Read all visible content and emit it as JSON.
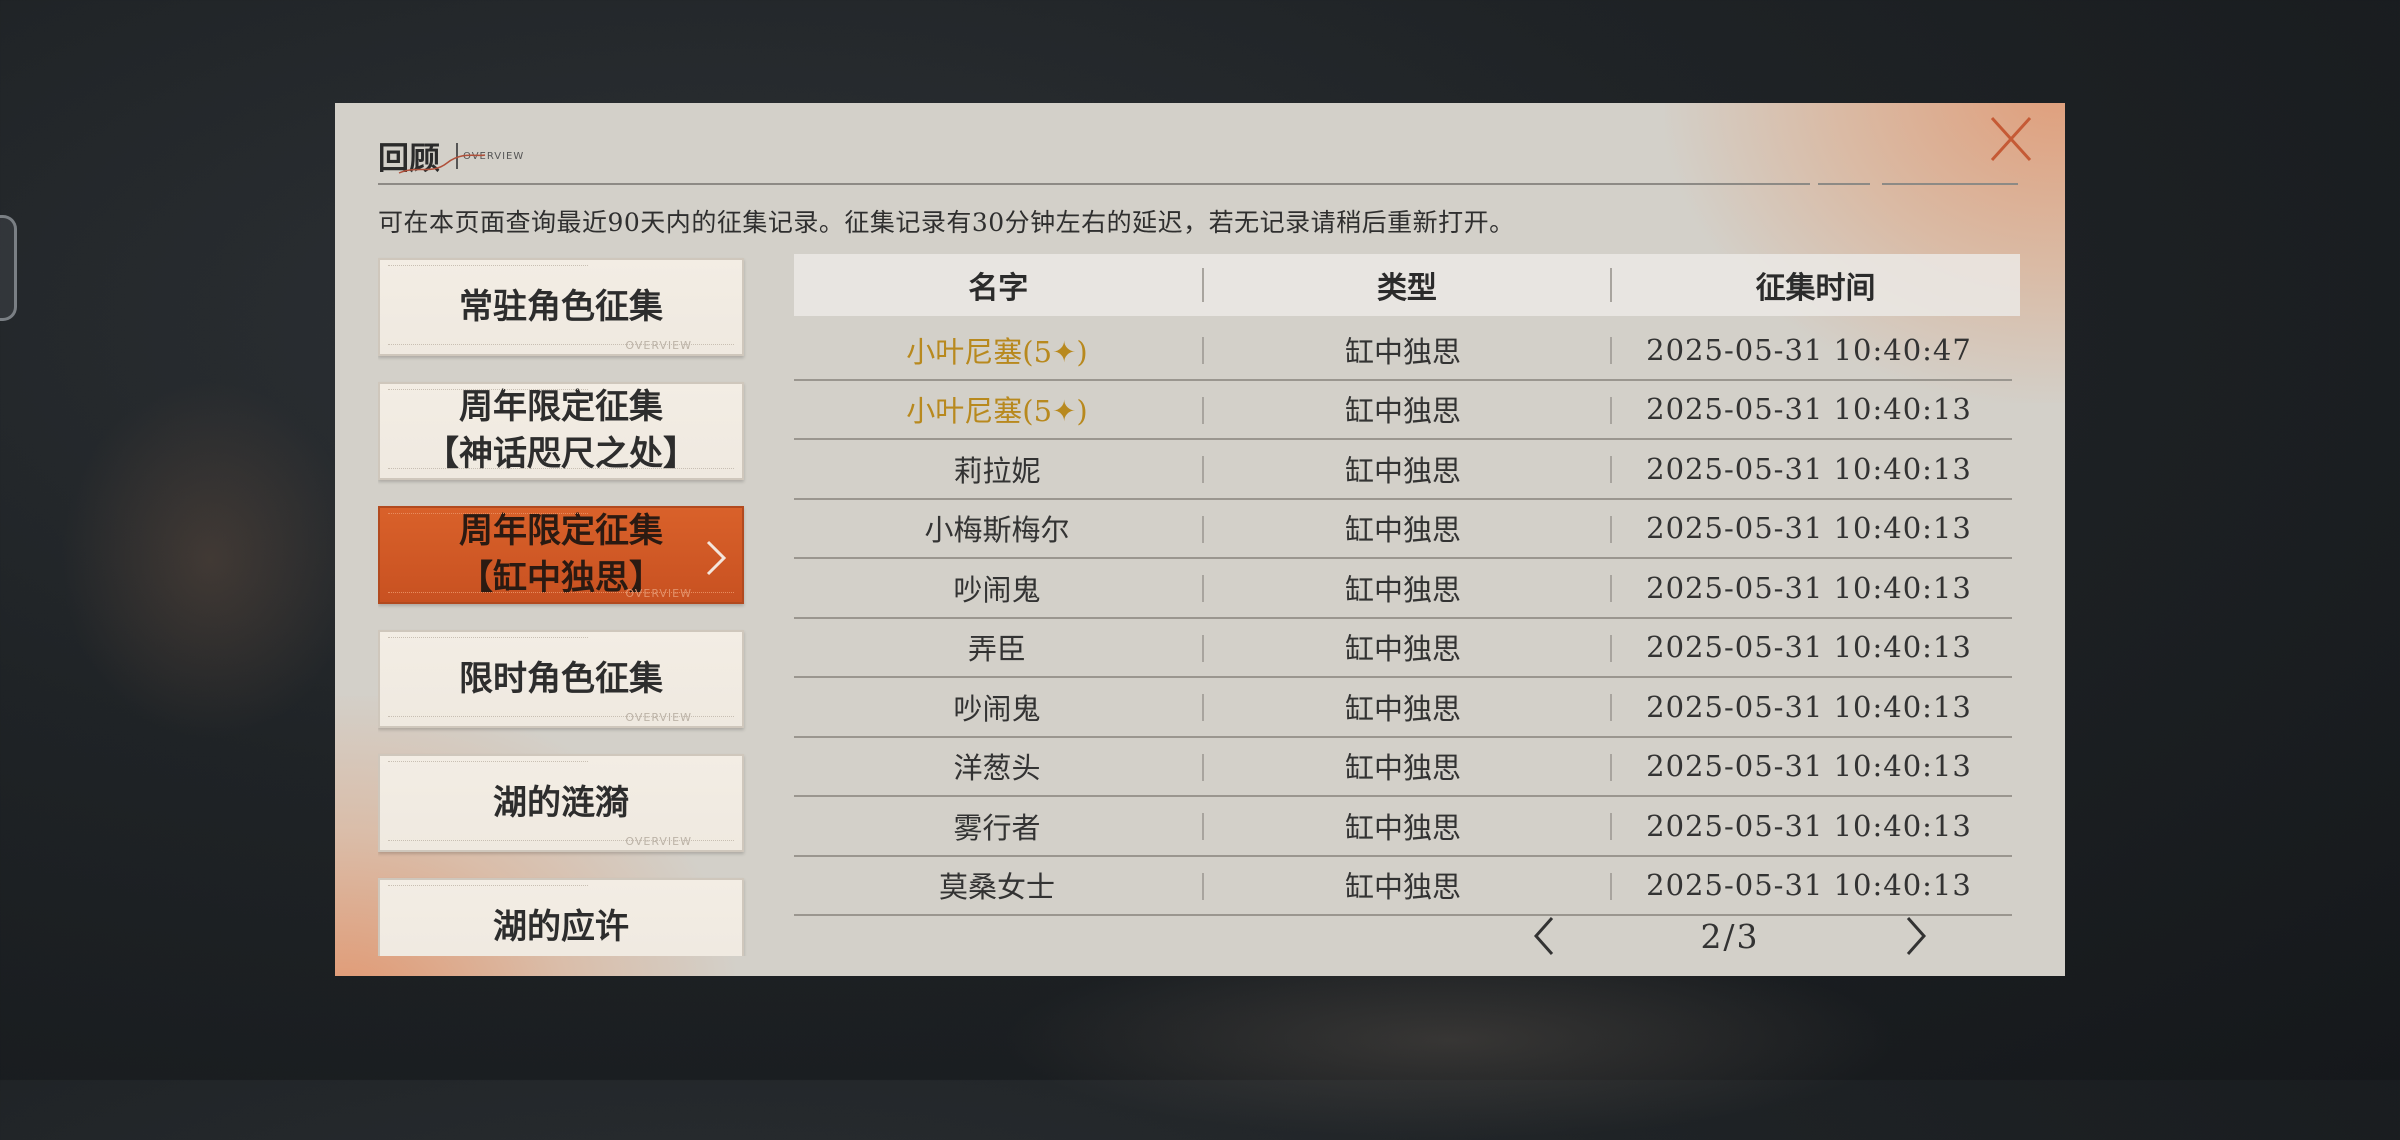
{
  "dialog": {
    "title": "回顾",
    "title_en": "OVERVIEW",
    "subtitle": "可在本页面查询最近90天内的征集记录。征集记录有30分钟左右的延迟，若无记录请稍后重新打开。"
  },
  "colors": {
    "accent": "#d15a25",
    "gold_text": "#b8891e",
    "panel": "#d3d0c9",
    "close_icon": "#c55a35"
  },
  "categories": [
    {
      "label": "常驻角色征集",
      "active": false
    },
    {
      "label": "周年限定征集\n【神话咫尺之处】",
      "active": false
    },
    {
      "label": "周年限定征集\n【缸中独思】",
      "active": true
    },
    {
      "label": "限时角色征集",
      "active": false
    },
    {
      "label": "湖的涟漪",
      "active": false
    },
    {
      "label": "湖的应许",
      "active": false
    }
  ],
  "category_deco_text": "OVERVIEW",
  "table": {
    "headers": {
      "name": "名字",
      "type": "类型",
      "time": "征集时间"
    },
    "rows": [
      {
        "name": "小叶尼塞(5✦)",
        "type": "缸中独思",
        "time": "2025-05-31 10:40:47",
        "rarity": 5
      },
      {
        "name": "小叶尼塞(5✦)",
        "type": "缸中独思",
        "time": "2025-05-31 10:40:13",
        "rarity": 5
      },
      {
        "name": "莉拉妮",
        "type": "缸中独思",
        "time": "2025-05-31 10:40:13",
        "rarity": 0
      },
      {
        "name": "小梅斯梅尔",
        "type": "缸中独思",
        "time": "2025-05-31 10:40:13",
        "rarity": 0
      },
      {
        "name": "吵闹鬼",
        "type": "缸中独思",
        "time": "2025-05-31 10:40:13",
        "rarity": 0
      },
      {
        "name": "弄臣",
        "type": "缸中独思",
        "time": "2025-05-31 10:40:13",
        "rarity": 0
      },
      {
        "name": "吵闹鬼",
        "type": "缸中独思",
        "time": "2025-05-31 10:40:13",
        "rarity": 0
      },
      {
        "name": "洋葱头",
        "type": "缸中独思",
        "time": "2025-05-31 10:40:13",
        "rarity": 0
      },
      {
        "name": "雾行者",
        "type": "缸中独思",
        "time": "2025-05-31 10:40:13",
        "rarity": 0
      },
      {
        "name": "莫桑女士",
        "type": "缸中独思",
        "time": "2025-05-31 10:40:13",
        "rarity": 0
      }
    ]
  },
  "pager": {
    "text": "2/3",
    "prev_icon": "chevron-left-icon",
    "next_icon": "chevron-right-icon"
  }
}
